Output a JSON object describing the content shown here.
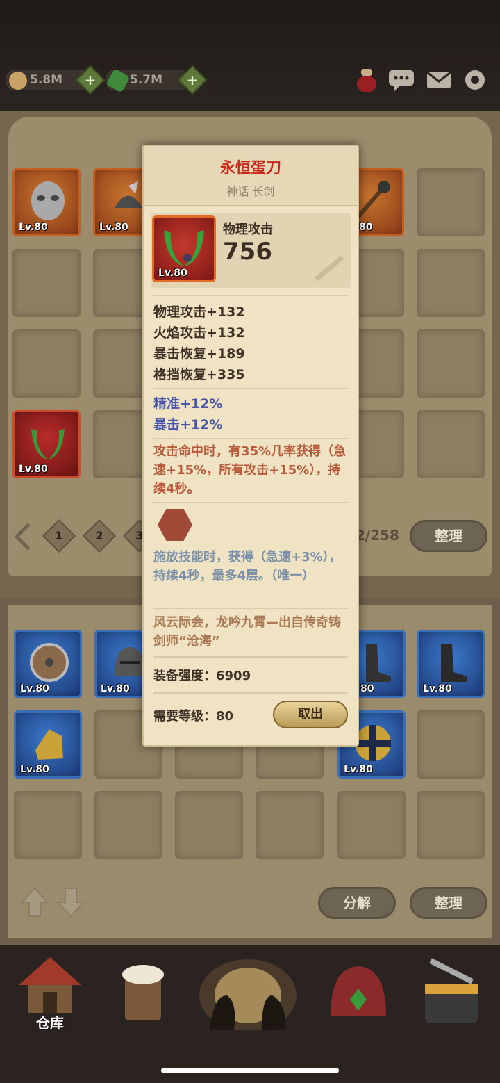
{
  "resources": {
    "gold": "5.8M",
    "gems": "5.7M",
    "plus": "+"
  },
  "header_icons": [
    "potion-icon",
    "chat-icon",
    "mail-icon",
    "settings-icon"
  ],
  "warehouse": {
    "top_items": [
      {
        "lv": "Lv.80",
        "art": "mask-icon"
      },
      {
        "lv": "Lv.80",
        "art": "feather-helmet-icon"
      },
      {
        "lv": "Lv.80",
        "art": "green-blade-icon"
      },
      {
        "lv": "80",
        "art": "mace-icon"
      }
    ],
    "pages": [
      "1",
      "2",
      "3"
    ],
    "page_count": "2/258",
    "sort_label": "整理"
  },
  "equipment_row": [
    {
      "lv": "Lv.80",
      "art": "shield-icon"
    },
    {
      "lv": "Lv.80",
      "art": "helmet-icon"
    },
    {
      "lv": "80",
      "art": "boots-icon"
    },
    {
      "lv": "Lv.80",
      "art": "boots-icon"
    },
    {
      "lv": "Lv.80",
      "art": "gauntlet-icon"
    },
    {
      "lv": "Lv.80",
      "art": "round-shield-icon"
    }
  ],
  "lower_buttons": {
    "dismantle": "分解",
    "sort": "整理"
  },
  "nav": {
    "warehouse": "仓库"
  },
  "card": {
    "name": "永恒蛋刀",
    "subtitle": "神话 长剑",
    "icon_lv": "Lv.80",
    "main_stat_label": "物理攻击",
    "main_stat_value": "756",
    "stats": [
      "物理攻击+132",
      "火焰攻击+132",
      "暴击恢复+189",
      "格挡恢复+335"
    ],
    "bonus_stats": [
      "精准+12%",
      "暴击+12%"
    ],
    "proc_text": "攻击命中时，有35%几率获得（急速+15%，所有攻击+15%），持续4秒。",
    "skill_text": "施放技能时，获得（急速+3%），持续4秒，最多4层。（唯一）",
    "flavor_text": "风云际会，龙吟九霄—出自传奇铸剑师“沧海”",
    "strength_label": "装备强度：6909",
    "level_req": "需要等级：80",
    "take_out": "取出"
  },
  "colors": {
    "item_name": "#c8271a",
    "bonus": "#4754a8",
    "proc": "#b75a3a",
    "skill": "#7a8fa8",
    "flavor": "#a97a55"
  }
}
